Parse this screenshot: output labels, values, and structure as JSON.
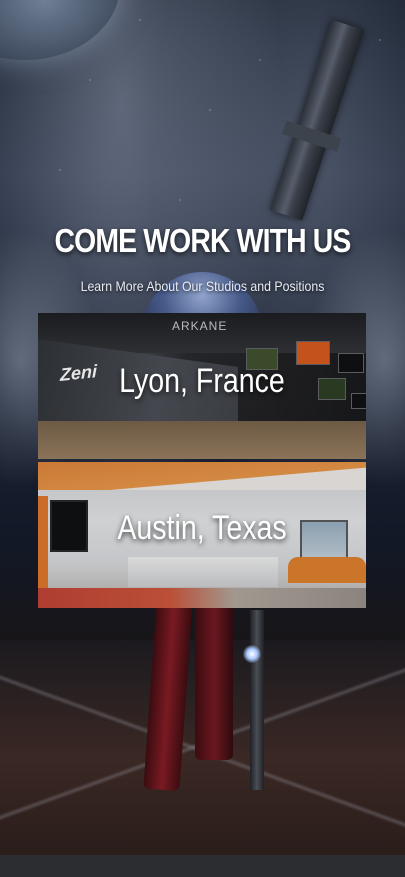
{
  "hero": {
    "headline": "COME WORK WITH US",
    "subheadline": "Learn More About Our Studios and Positions"
  },
  "studios": [
    {
      "location": "Lyon, France",
      "sign_texts": [
        "ARKANE",
        "Zeni"
      ]
    },
    {
      "location": "Austin, Texas"
    }
  ],
  "colors": {
    "headline": "#ffffff",
    "card_title": "#ffffff",
    "footer_bar": "#2b2d30"
  }
}
